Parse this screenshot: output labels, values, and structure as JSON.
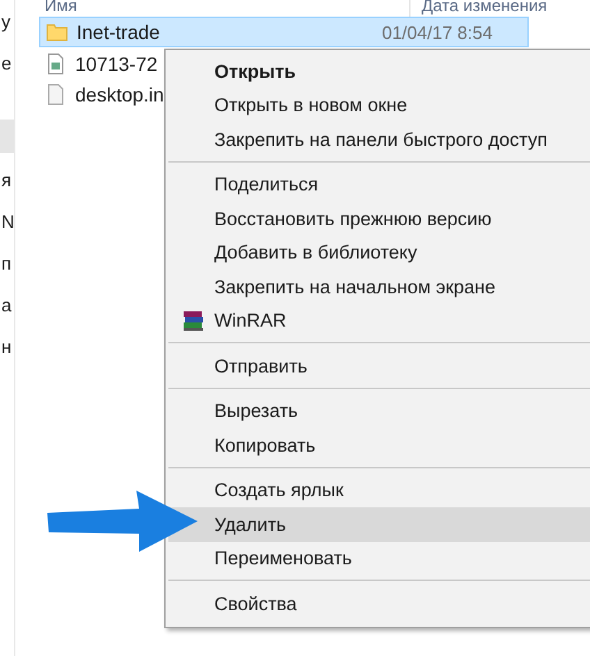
{
  "sidebar": {
    "items": [
      {
        "label": "у",
        "selected": false
      },
      {
        "label": "е",
        "selected": false
      },
      {
        "selected": true
      },
      {
        "label": "я",
        "selected": false
      },
      {
        "label": "N",
        "selected": false
      },
      {
        "label": "п",
        "selected": false
      },
      {
        "label": "а",
        "selected": false
      },
      {
        "label": "н",
        "selected": false
      }
    ]
  },
  "table": {
    "columns": [
      "Имя",
      "Дата изменения"
    ],
    "rows": [
      {
        "kind": "folder",
        "name": "Inet-trade",
        "date": "01/04/17 8:54",
        "selected": true
      },
      {
        "kind": "image",
        "name": "10713-72",
        "selected": false
      },
      {
        "kind": "file",
        "name": "desktop.in",
        "selected": false
      }
    ]
  },
  "context_menu": {
    "groups": [
      [
        {
          "label": "Открыть",
          "default": true,
          "selected": false,
          "kind": "plain"
        },
        {
          "label": "Открыть в новом окне",
          "default": false,
          "selected": false,
          "kind": "plain"
        },
        {
          "label": "Закрепить на панели быстрого доступ",
          "default": false,
          "selected": false,
          "kind": "plain"
        }
      ],
      [
        {
          "label": "Поделиться",
          "default": false,
          "selected": false,
          "kind": "plain"
        },
        {
          "label": "Восстановить прежнюю версию",
          "default": false,
          "selected": false,
          "kind": "plain"
        },
        {
          "label": "Добавить в библиотеку",
          "default": false,
          "selected": false,
          "kind": "plain"
        },
        {
          "label": "Закрепить на начальном экране",
          "default": false,
          "selected": false,
          "kind": "plain"
        },
        {
          "label": "WinRAR",
          "default": false,
          "selected": false,
          "kind": "archiver"
        }
      ],
      [
        {
          "label": "Отправить",
          "default": false,
          "selected": false,
          "kind": "plain"
        }
      ],
      [
        {
          "label": "Вырезать",
          "default": false,
          "selected": false,
          "kind": "plain"
        },
        {
          "label": "Копировать",
          "default": false,
          "selected": false,
          "kind": "plain"
        }
      ],
      [
        {
          "label": "Создать ярлык",
          "default": false,
          "selected": false,
          "kind": "plain"
        },
        {
          "label": "Удалить",
          "default": false,
          "selected": true,
          "kind": "plain"
        },
        {
          "label": "Переименовать",
          "default": false,
          "selected": false,
          "kind": "plain"
        }
      ],
      [
        {
          "label": "Свойства",
          "default": false,
          "selected": false,
          "kind": "plain"
        }
      ]
    ]
  }
}
